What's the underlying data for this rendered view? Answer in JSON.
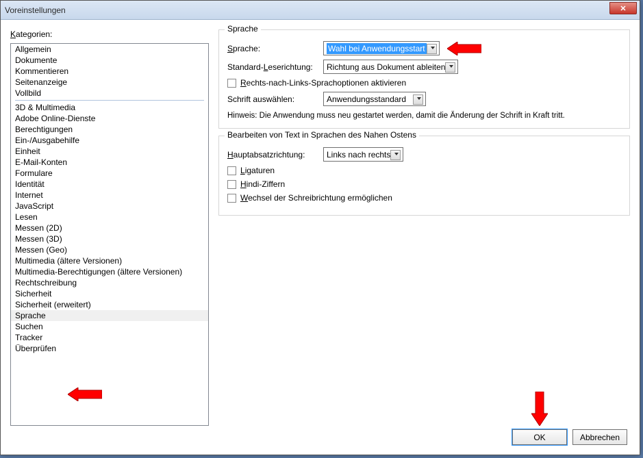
{
  "window": {
    "title": "Voreinstellungen"
  },
  "left": {
    "label": "Kategorien:",
    "group1": [
      "Allgemein",
      "Dokumente",
      "Kommentieren",
      "Seitenanzeige",
      "Vollbild"
    ],
    "group2": [
      "3D & Multimedia",
      "Adobe Online-Dienste",
      "Berechtigungen",
      "Ein-/Ausgabehilfe",
      "Einheit",
      "E-Mail-Konten",
      "Formulare",
      "Identität",
      "Internet",
      "JavaScript",
      "Lesen",
      "Messen (2D)",
      "Messen (3D)",
      "Messen (Geo)",
      "Multimedia (ältere Versionen)",
      "Multimedia-Berechtigungen (ältere Versionen)",
      "Rechtschreibung",
      "Sicherheit",
      "Sicherheit (erweitert)",
      "Sprache",
      "Suchen",
      "Tracker",
      "Überprüfen"
    ],
    "selected": "Sprache"
  },
  "lang_group": {
    "title": "Sprache",
    "sprache_label": "Sprache:",
    "sprache_value": "Wahl bei Anwendungsstart",
    "reading_label": "Standard-Leserichtung:",
    "reading_value": "Richtung aus Dokument ableiten",
    "rtl_checkbox": "Rechts-nach-Links-Sprachoptionen aktivieren",
    "font_label": "Schrift auswählen:",
    "font_value": "Anwendungsstandard",
    "hint": "Hinweis: Die Anwendung muss neu gestartet werden, damit die Änderung der Schrift in Kraft tritt."
  },
  "me_group": {
    "title": "Bearbeiten von Text in Sprachen des Nahen Ostens",
    "dir_label": "Hauptabsatzrichtung:",
    "dir_value": "Links nach rechts",
    "ligatures": "Ligaturen",
    "hindi": "Hindi-Ziffern",
    "wechsel": "Wechsel der Schreibrichtung ermöglichen"
  },
  "buttons": {
    "ok": "OK",
    "cancel": "Abbrechen"
  }
}
